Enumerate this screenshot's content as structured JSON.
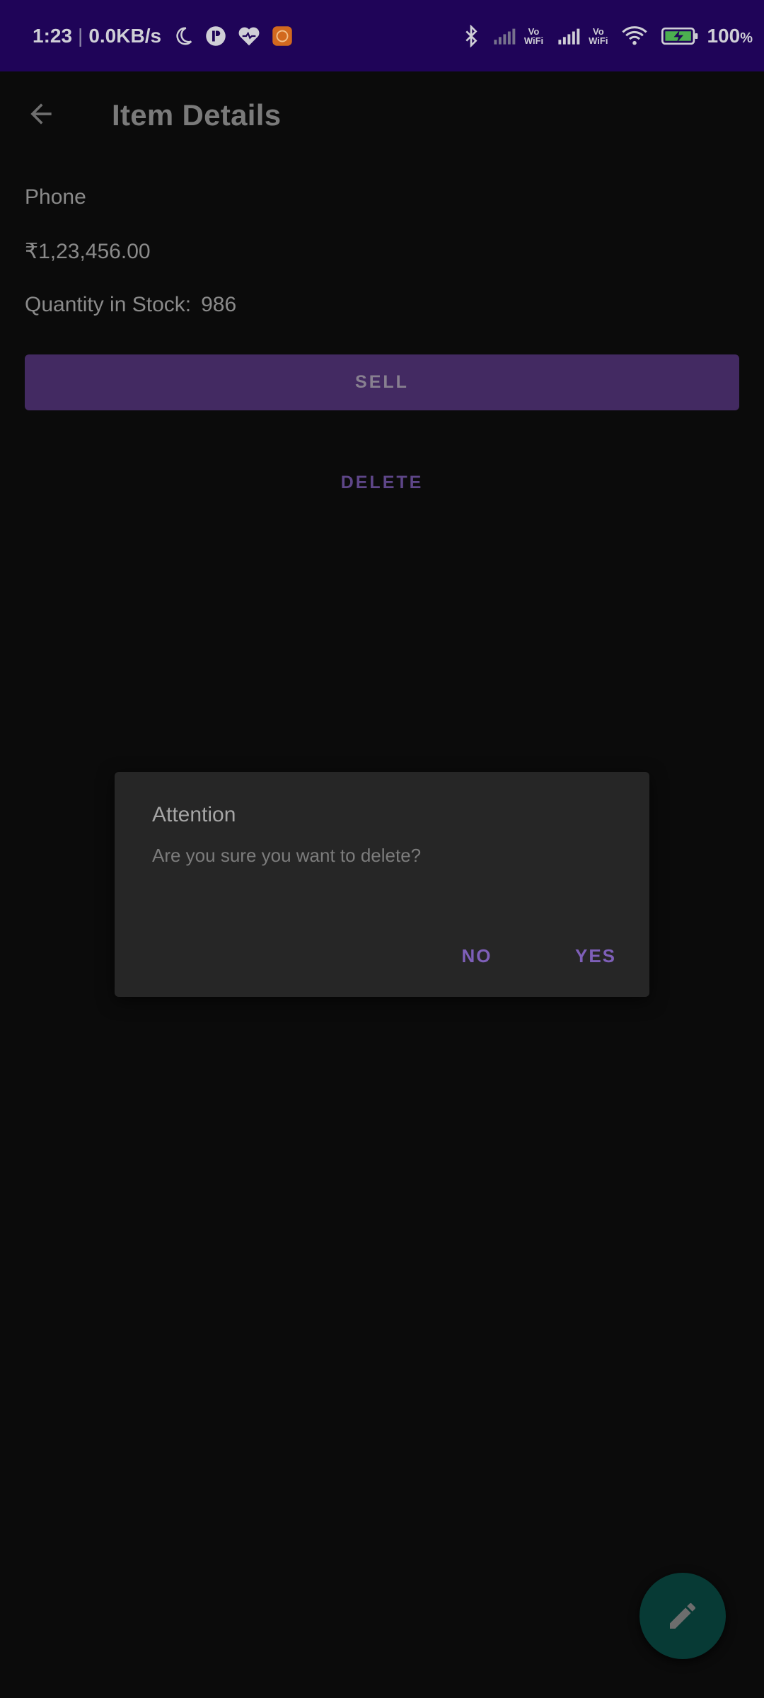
{
  "status_bar": {
    "time": "1:23",
    "network_speed": "0.0KB/s",
    "battery_percent": "100",
    "battery_unit": "%",
    "vowifi_1_top": "Vo",
    "vowifi_1_bottom": "WiFi",
    "vowifi_2_top": "Vo",
    "vowifi_2_bottom": "WiFi",
    "icons": [
      "moon-icon",
      "app-icon",
      "heart-icon",
      "app-badge-icon",
      "bluetooth-icon",
      "signal-icon",
      "signal-icon",
      "wifi-icon",
      "battery-charging-icon"
    ]
  },
  "app_bar": {
    "title": "Item Details",
    "back_icon": "arrow-back-icon"
  },
  "item": {
    "name": "Phone",
    "price": "₹1,23,456.00",
    "quantity_label": "Quantity in Stock:",
    "quantity_value": "986"
  },
  "actions": {
    "sell_label": "SELL",
    "delete_label": "DELETE"
  },
  "dialog": {
    "title": "Attention",
    "message": "Are you sure you want to delete?",
    "no_label": "NO",
    "yes_label": "YES"
  },
  "fab": {
    "icon": "edit-pencil-icon"
  },
  "colors": {
    "status_bar": "#1f0458",
    "background": "#0b0b0b",
    "sell_button": "#432a62",
    "accent_text": "#7e5fb8",
    "dialog_surface": "#262626",
    "fab": "#073a35"
  }
}
